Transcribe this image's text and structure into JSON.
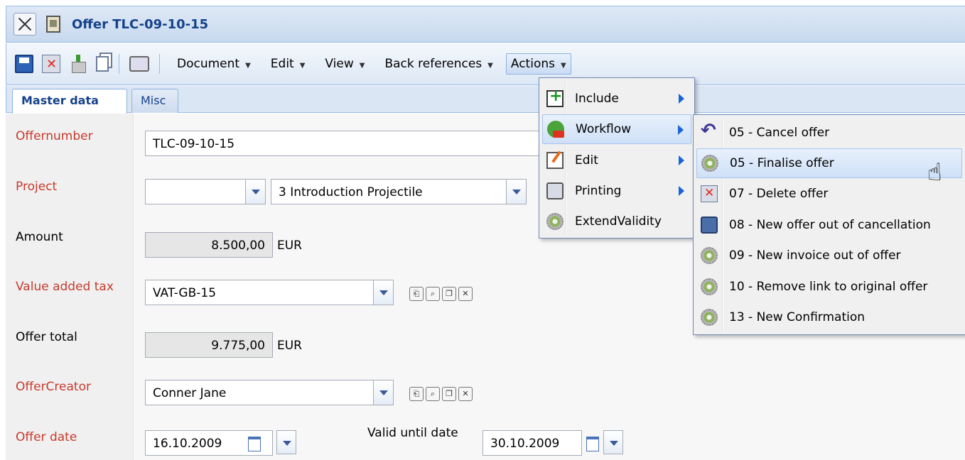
{
  "window": {
    "title": "Offer TLC-09-10-15"
  },
  "toolbar": {
    "icons": [
      "save-icon",
      "delete-icon",
      "import-icon",
      "copy-icon",
      "print-icon"
    ],
    "menus": [
      "Document",
      "Edit",
      "View",
      "Back references",
      "Actions"
    ]
  },
  "tabs": [
    "Master data",
    "Misc"
  ],
  "form": {
    "offernumber": {
      "label": "Offernumber",
      "value": "TLC-09-10-15"
    },
    "project": {
      "label": "Project",
      "value1": "",
      "value2": "3 Introduction Projectile"
    },
    "amount": {
      "label": "Amount",
      "value": "8.500,00",
      "unit": "EUR"
    },
    "vat": {
      "label": "Value added tax",
      "value": "VAT-GB-15"
    },
    "offer_total": {
      "label": "Offer total",
      "value": "9.775,00",
      "unit": "EUR"
    },
    "offer_creator": {
      "label": "OfferCreator",
      "value": "Conner Jane"
    },
    "offer_date": {
      "label": "Offer date",
      "value": "16.10.2009"
    },
    "valid_until": {
      "label": "Valid until date",
      "value": "30.10.2009"
    }
  },
  "actions_menu": {
    "items": [
      "Include",
      "Workflow",
      "Edit",
      "Printing",
      "ExtendValidity"
    ],
    "highlighted": "Workflow"
  },
  "workflow_menu": {
    "items": [
      "05 - Cancel offer",
      "05 - Finalise offer",
      "07 - Delete offer",
      "08 - New offer out of cancellation",
      "09 - New invoice out of offer",
      "10 - Remove link to original offer",
      "13 - New Confirmation"
    ],
    "highlighted": "05 - Finalise offer"
  },
  "colors": {
    "required_label": "#c73a2c",
    "title": "#15428b",
    "menu_highlight": "#cfe0f7"
  }
}
